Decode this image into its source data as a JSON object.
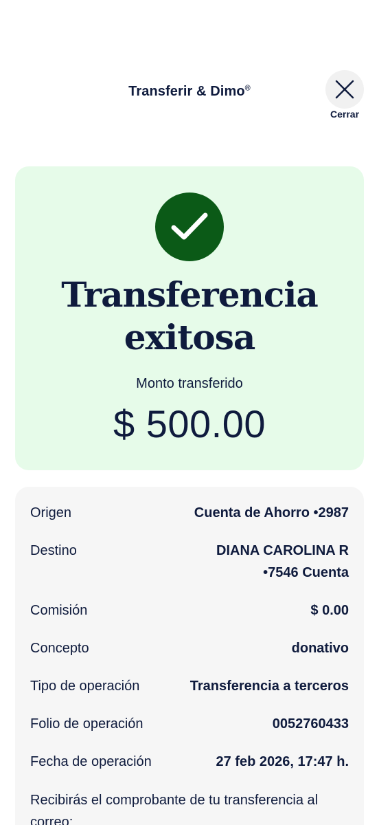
{
  "header": {
    "title": "Transferir & Dimo",
    "title_mark": "®",
    "close_label": "Cerrar",
    "close_icon": "close-icon"
  },
  "success": {
    "icon": "check-circle-icon",
    "title_line1": "Transferencia",
    "title_line2": "exitosa",
    "amount_label": "Monto transferido",
    "amount": "$ 500.00",
    "background_color": "#e6fbe9",
    "icon_color": "#0b5a17"
  },
  "details": {
    "rows": [
      {
        "label": "Origen",
        "value": "Cuenta de Ahorro •2987"
      },
      {
        "label": "Destino",
        "value_line1": "DIANA CAROLINA R",
        "value_line2": "•7546 Cuenta"
      },
      {
        "label": "Comisión",
        "value": "$ 0.00"
      },
      {
        "label": "Concepto",
        "value": "donativo"
      },
      {
        "label": "Tipo de operación",
        "value": "Transferencia a terceros"
      },
      {
        "label": "Folio de operación",
        "value": "0052760433"
      },
      {
        "label": "Fecha de operación",
        "value": "27 feb 2026, 17:47 h."
      }
    ],
    "email_note": "Recibirás el comprobante de tu transferencia al correo:"
  },
  "colors": {
    "text_primary": "#0f1b3d",
    "details_background": "#f6f6f6"
  }
}
